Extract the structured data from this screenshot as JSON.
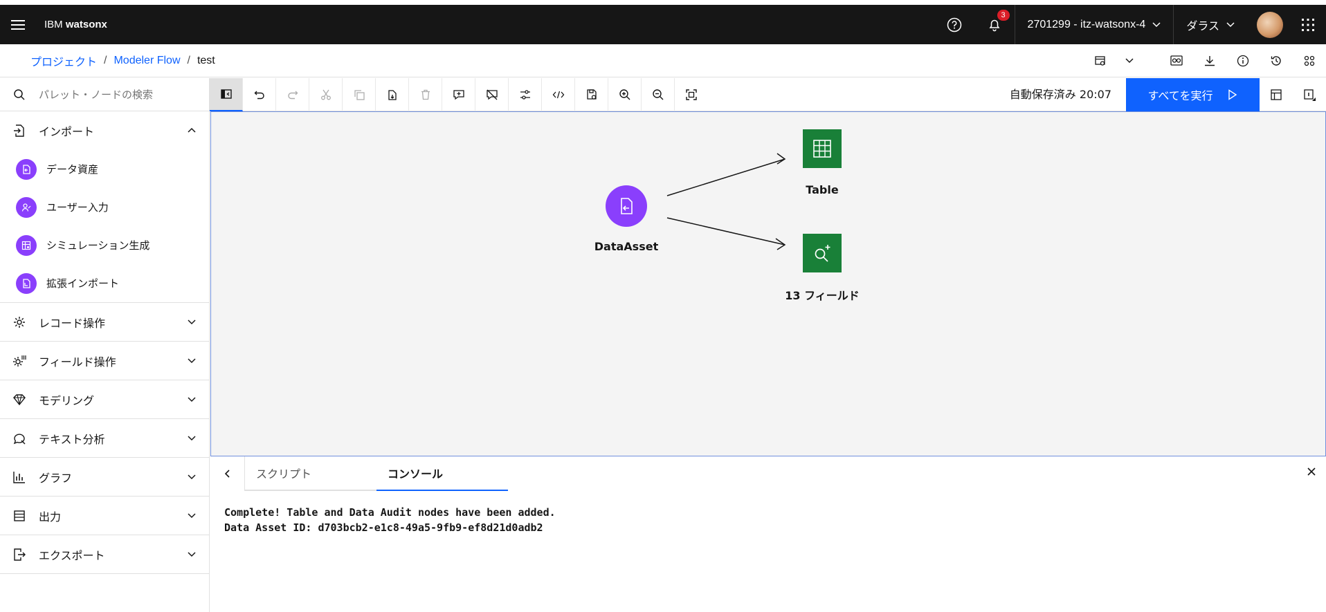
{
  "header": {
    "brand_prefix": "IBM ",
    "brand_name": "watsonx",
    "notification_count": "3",
    "account": "2701299 - itz-watsonx-4",
    "region": "ダラス"
  },
  "breadcrumb": {
    "items": [
      "プロジェクト",
      "Modeler Flow"
    ],
    "current": "test"
  },
  "search": {
    "placeholder": "パレット・ノードの検索"
  },
  "toolbar": {
    "autosave": "自動保存済み 20:07",
    "run_all": "すべてを実行"
  },
  "sidebar": {
    "import": {
      "label": "インポート",
      "items": [
        "データ資産",
        "ユーザー入力",
        "シミュレーション生成",
        "拡張インポート"
      ]
    },
    "categories": [
      "レコード操作",
      "フィールド操作",
      "モデリング",
      "テキスト分析",
      "グラフ",
      "出力",
      "エクスポート"
    ]
  },
  "canvas": {
    "nodes": {
      "source": "DataAsset",
      "table": "Table",
      "audit": "13 フィールド"
    }
  },
  "panel": {
    "tabs": [
      "スクリプト",
      "コンソール"
    ],
    "active_tab": "コンソール",
    "console_lines": [
      "Complete! Table and Data Audit nodes have been added.",
      "Data Asset ID: d703bcb2-e1c8-49a5-9fb9-ef8d21d0adb2"
    ]
  },
  "colors": {
    "accent": "#0f62fe",
    "node_purple": "#8a3ffc",
    "node_green": "#198038",
    "header_bg": "#161616"
  }
}
